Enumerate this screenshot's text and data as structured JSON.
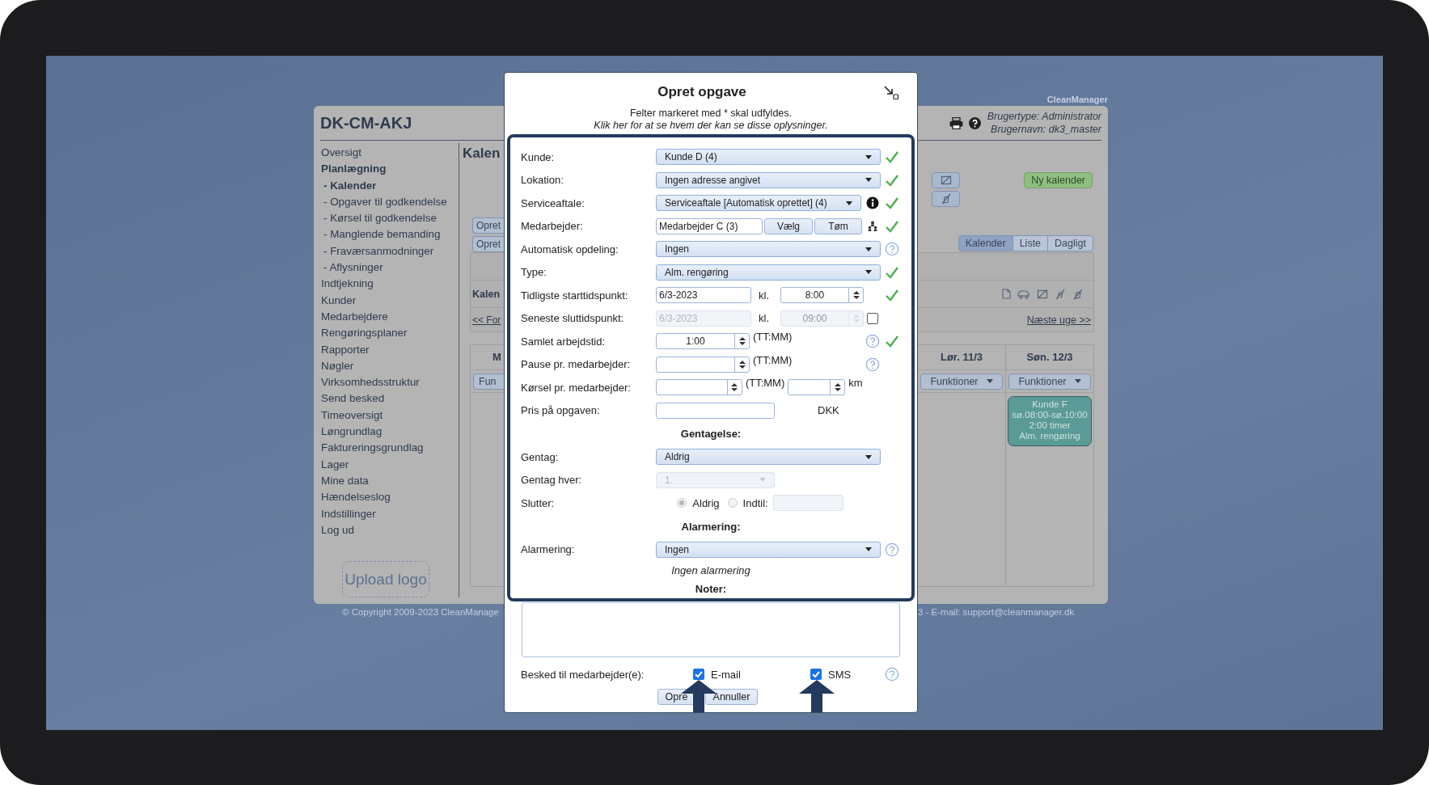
{
  "brand": "CleanManager",
  "app": {
    "title": "DK-CM-AKJ",
    "user_type": "Brugertype: Administrator",
    "user_name": "Brugernavn: dk3_master",
    "sidebar": [
      {
        "label": "Oversigt",
        "selected": false
      },
      {
        "label": "Planlægning",
        "selected": true,
        "children": [
          {
            "label": "- Kalender",
            "selected": true
          },
          {
            "label": "- Opgaver til godkendelse",
            "selected": false
          },
          {
            "label": "- Kørsel til godkendelse",
            "selected": false
          },
          {
            "label": "- Manglende bemanding",
            "selected": false
          },
          {
            "label": "- Fraværsanmodninger",
            "selected": false
          },
          {
            "label": "- Aflysninger",
            "selected": false
          }
        ]
      },
      {
        "label": "Indtjekning",
        "selected": false
      },
      {
        "label": "Kunder",
        "selected": false
      },
      {
        "label": "Medarbejdere",
        "selected": false
      },
      {
        "label": "Rengøringsplaner",
        "selected": false
      },
      {
        "label": "Rapporter",
        "selected": false
      },
      {
        "label": "Nøgler",
        "selected": false
      },
      {
        "label": "Virksomhedsstruktur",
        "selected": false
      },
      {
        "label": "Send besked",
        "selected": false
      },
      {
        "label": "Timeoversigt",
        "selected": false
      },
      {
        "label": "Løngrundlag",
        "selected": false
      },
      {
        "label": "Faktureringsgrundlag",
        "selected": false
      },
      {
        "label": "Lager",
        "selected": false
      },
      {
        "label": "Mine data",
        "selected": false
      },
      {
        "label": "Hændelseslog",
        "selected": false
      },
      {
        "label": "Indstillinger",
        "selected": false
      },
      {
        "label": "Log ud",
        "selected": false
      }
    ],
    "upload_logo": "Upload logo",
    "main": {
      "heading": "Kalen",
      "create_buttons": [
        "Opret",
        "Opret"
      ],
      "new_calendar": "Ny kalender",
      "view_tabs": [
        {
          "label": "Kalender",
          "selected": true
        },
        {
          "label": "Liste",
          "selected": false
        },
        {
          "label": "Dagligt",
          "selected": false
        }
      ],
      "calendar_label": "Kalen",
      "prev_week": "<< For",
      "next_week": "Næste uge >>",
      "days": [
        {
          "label": "M",
          "menu": "Fun"
        },
        {
          "label": "Lør. 11/3",
          "menu": "Funktioner"
        },
        {
          "label": "Søn. 12/3",
          "menu": "Funktioner",
          "events": [
            {
              "customer": "Kunde F",
              "time": "sø.08:00-sø.10:00",
              "duration": "2:00 timer",
              "type": "Alm. rengøring",
              "color": "#5b9b97"
            }
          ]
        }
      ]
    },
    "footer_left": "© Copyright 2009-2023 CleanManage",
    "footer_right": "3 - E-mail: support@cleanmanager.dk"
  },
  "dialog": {
    "title": "Opret opgave",
    "required_note": "Felter markeret med * skal udfyldes.",
    "info_link": "Klik her for at se hvem der kan se disse oplysninger.",
    "fields": [
      {
        "kind": "select",
        "label": "Kunde:",
        "value": "Kunde D (4)",
        "valid": true
      },
      {
        "kind": "select",
        "label": "Lokation:",
        "value": "Ingen adresse angivet",
        "valid": true
      },
      {
        "kind": "select",
        "label": "Serviceaftale:",
        "value": "Serviceaftale [Automatisk oprettet] (4)",
        "info": true,
        "valid": true
      },
      {
        "kind": "picker",
        "label": "Medarbejder:",
        "value": "Medarbejder C (3)",
        "buttons": [
          "Vælg",
          "Tøm"
        ],
        "valid": true
      },
      {
        "kind": "select",
        "label": "Automatisk opdeling:",
        "value": "Ingen",
        "help": true,
        "valid": false
      },
      {
        "kind": "select",
        "label": "Type:",
        "value": "Alm. rengøring",
        "valid": true
      },
      {
        "kind": "datetime",
        "label": "Tidligste starttidspunkt:",
        "date": "6/3-2023",
        "at": "kl.",
        "time": "8:00",
        "disabled": false,
        "valid": true
      },
      {
        "kind": "datetime",
        "label": "Seneste sluttidspunkt:",
        "date": "6/3-2023",
        "at": "kl.",
        "time": "09:00",
        "disabled": true,
        "checked": false,
        "valid": false
      },
      {
        "kind": "duration",
        "label": "Samlet arbejdstid:",
        "value": "1:00",
        "unit": "(TT:MM)",
        "help": true,
        "valid": true
      },
      {
        "kind": "duration",
        "label": "Pause pr. medarbejder:",
        "unit": "(TT:MM)",
        "help": true,
        "valid": false
      },
      {
        "kind": "distance",
        "label": "Kørsel pr. medarbejder:",
        "unit": "(TT:MM)",
        "distance_unit": "km"
      },
      {
        "kind": "price",
        "label": "Pris på opgaven:",
        "currency": "DKK"
      },
      {
        "kind": "heading",
        "label": "Gentagelse:"
      },
      {
        "kind": "select",
        "label": "Gentag:",
        "value": "Aldrig",
        "valid": false
      },
      {
        "kind": "select_short",
        "label": "Gentag hver:",
        "value": "1.",
        "disabled": true
      },
      {
        "kind": "end",
        "label": "Slutter:",
        "disabled": true,
        "options": [
          {
            "label": "Aldrig",
            "selected": true
          },
          {
            "label": "Indtil:",
            "selected": false
          }
        ]
      },
      {
        "kind": "heading",
        "label": "Alarmering:"
      },
      {
        "kind": "select",
        "label": "Alarmering:",
        "value": "Ingen",
        "help": true,
        "valid": false
      },
      {
        "kind": "note",
        "label": "Ingen alarmering"
      },
      {
        "kind": "heading",
        "label": "Noter:"
      }
    ],
    "notify": {
      "label": "Besked til medarbejder(e):",
      "help": true,
      "options": [
        {
          "label": "E-mail",
          "checked": true
        },
        {
          "label": "SMS",
          "checked": true
        }
      ]
    },
    "buttons": [
      "Opre",
      "Annuller"
    ]
  }
}
